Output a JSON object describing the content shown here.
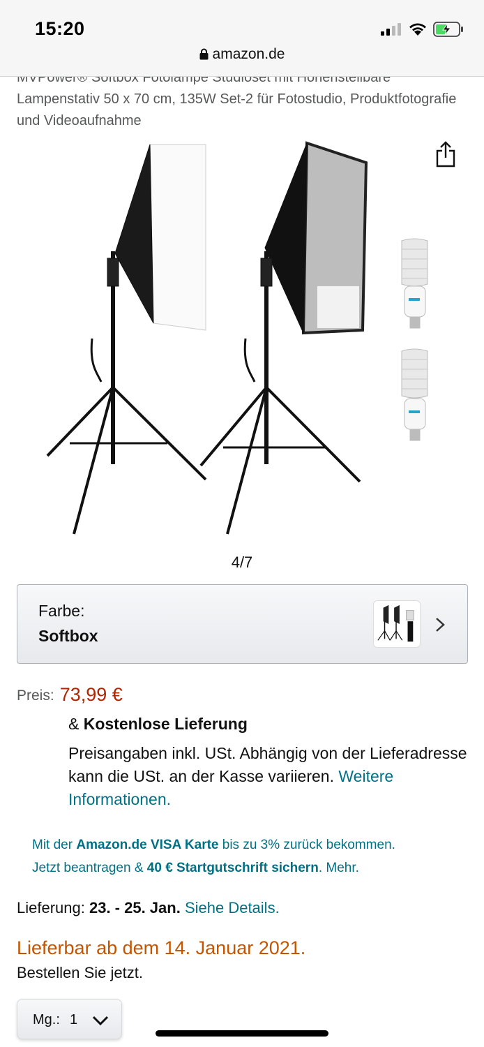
{
  "status": {
    "time": "15:20",
    "url": "amazon.de"
  },
  "product": {
    "title": "MVPower® Softbox Fotolampe Studioset mit Höhenstellbare Lampenstativ 50 x 70 cm, 135W Set-2 für Fotostudio, Produktfotografie und Videoaufnahme",
    "image_counter": "4/7"
  },
  "variant": {
    "label": "Farbe:",
    "value": "Softbox"
  },
  "price": {
    "label": "Preis:",
    "value": "73,99 €"
  },
  "shipping": {
    "prefix": "& ",
    "free_delivery": "Kostenlose Lieferung",
    "tax_note": "Preisangaben inkl. USt. Abhängig von der Lieferadresse kann die USt. an der Kasse variieren.",
    "more_info_link": "Weitere Informationen."
  },
  "visa_promo": {
    "text1": "Mit der ",
    "bold1": "Amazon.de VISA Karte",
    "text2": " bis zu 3% zurück bekommen.",
    "text3": "Jetzt beantragen & ",
    "bold2": "40 € Startgutschrift sichern",
    "text4": ". Mehr."
  },
  "delivery": {
    "label": "Lieferung: ",
    "dates": "23. - 25. Jan.",
    "details_link": " Siehe Details."
  },
  "availability": {
    "text": "Lieferbar ab dem 14. Januar 2021.",
    "order_now": "Bestellen Sie jetzt."
  },
  "quantity": {
    "label": "Mg.:",
    "value": "1"
  },
  "colors": {
    "link": "#007185",
    "price": "#b12704",
    "availability": "#c45500"
  },
  "icons": [
    "lock-icon",
    "share-icon",
    "chevron-right-icon",
    "chevron-down-icon",
    "signal-icon",
    "wifi-icon",
    "battery-charging-icon"
  ]
}
